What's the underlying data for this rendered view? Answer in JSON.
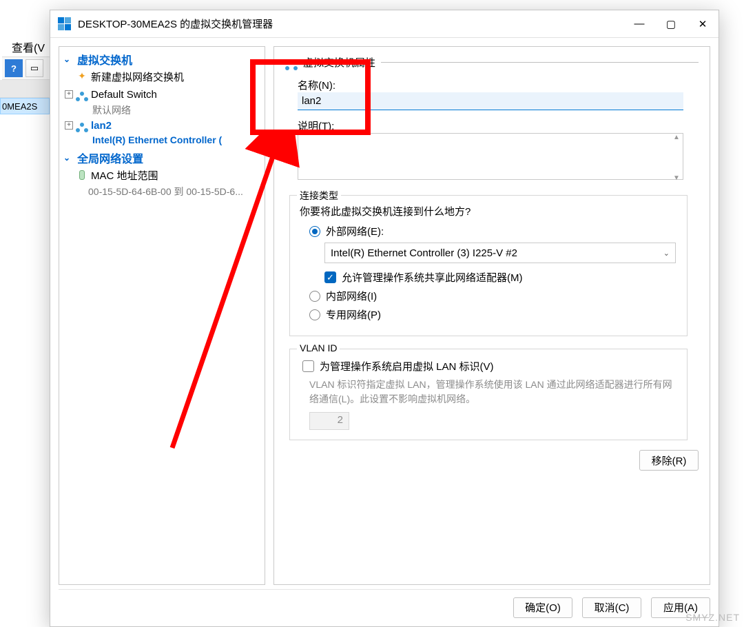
{
  "host": {
    "view_menu": "查看(V",
    "toolbar_help_icon": "?",
    "sidebar_selected": "0MEA2S"
  },
  "dialog": {
    "title": "DESKTOP-30MEA2S 的虚拟交换机管理器",
    "left": {
      "section_switches": "虚拟交换机",
      "new_switch": "新建虚拟网络交换机",
      "default_switch": "Default Switch",
      "default_switch_sub": "默认网络",
      "selected_switch": "lan2",
      "selected_switch_sub": "Intel(R) Ethernet Controller (",
      "section_global": "全局网络设置",
      "mac_range": "MAC 地址范围",
      "mac_range_sub": "00-15-5D-64-6B-00 到 00-15-5D-6..."
    },
    "right": {
      "props_title": "虚拟交换机属性",
      "name_label": "名称(N):",
      "name_value": "lan2",
      "desc_label": "说明(T):",
      "desc_value": "",
      "conn_type": "连接类型",
      "conn_q": "你要将此虚拟交换机连接到什么地方?",
      "radio_external": "外部网络(E):",
      "combo_value": "Intel(R) Ethernet Controller (3) I225-V #2",
      "chk_share": "允许管理操作系统共享此网络适配器(M)",
      "radio_internal": "内部网络(I)",
      "radio_private": "专用网络(P)",
      "vlan_title": "VLAN ID",
      "chk_vlan": "为管理操作系统启用虚拟 LAN 标识(V)",
      "vlan_hint": "VLAN 标识符指定虚拟 LAN，管理操作系统使用该 LAN 通过此网络适配器进行所有网络通信(L)。此设置不影响虚拟机网络。",
      "vlan_value": "2",
      "remove": "移除(R)"
    },
    "buttons": {
      "ok": "确定(O)",
      "cancel": "取消(C)",
      "apply": "应用(A)"
    }
  },
  "watermark": "SMYZ.NET"
}
